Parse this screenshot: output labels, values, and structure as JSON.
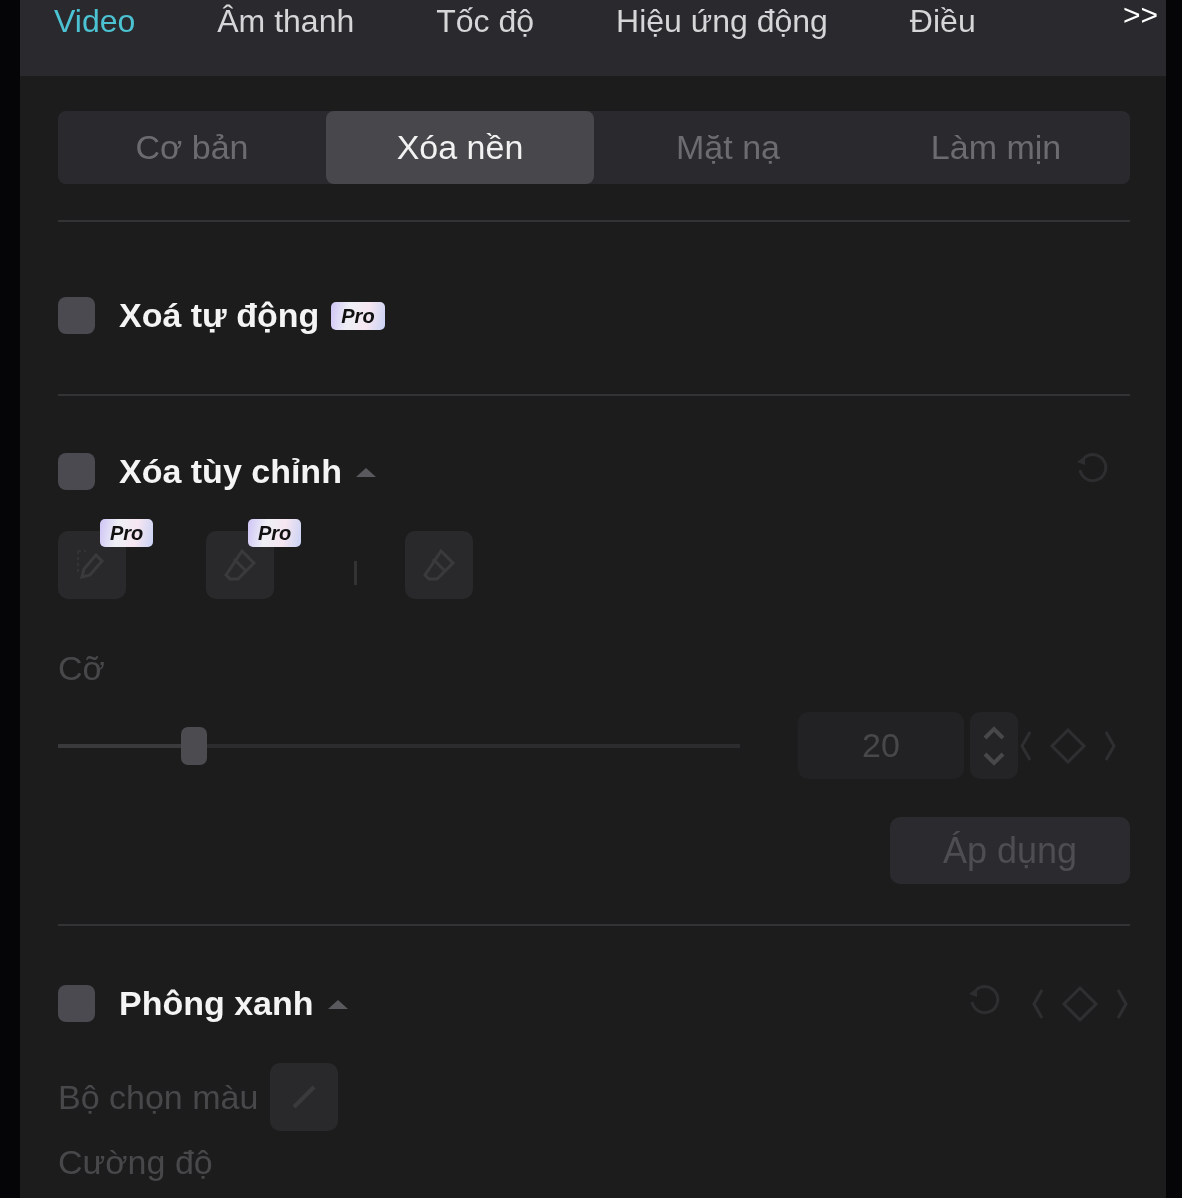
{
  "top_tabs": [
    {
      "label": "Video",
      "selected": true
    },
    {
      "label": "Âm thanh",
      "selected": false
    },
    {
      "label": "Tốc độ",
      "selected": false
    },
    {
      "label": "Hiệu ứng động",
      "selected": false
    },
    {
      "label": "Điều",
      "selected": false
    }
  ],
  "more_button": ">>",
  "sub_tabs": [
    {
      "label": "Cơ bản",
      "selected": false
    },
    {
      "label": "Xóa nền",
      "selected": true
    },
    {
      "label": "Mặt nạ",
      "selected": false
    },
    {
      "label": "Làm mịn",
      "selected": false
    }
  ],
  "auto_remove": {
    "label": "Xoá tự động",
    "checked": false,
    "badge": "Pro"
  },
  "custom_remove": {
    "label": "Xóa tùy chỉnh",
    "checked": false,
    "expanded": true,
    "tools": [
      {
        "kind": "brush",
        "badge": "Pro"
      },
      {
        "kind": "eraser",
        "badge": "Pro"
      },
      {
        "kind": "separator"
      },
      {
        "kind": "eraser"
      }
    ],
    "size_label": "Cỡ",
    "size_slider": {
      "level": 0.2
    },
    "size_value": "20",
    "apply_button": "Áp dụng"
  },
  "chroma_key": {
    "label": "Phông xanh",
    "checked": false,
    "expanded": true,
    "color_picker_label": "Bộ chọn màu",
    "strength_label": "Cường độ"
  }
}
